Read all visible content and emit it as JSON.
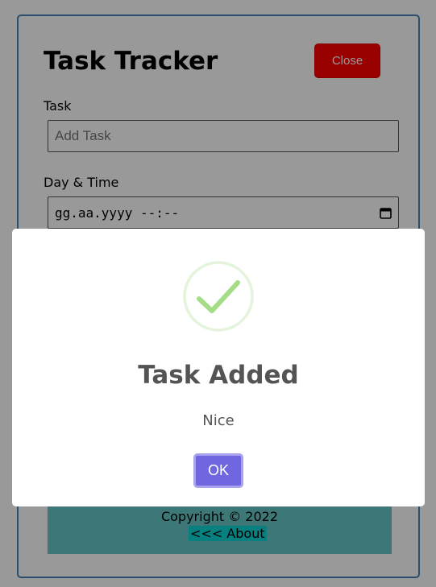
{
  "app": {
    "title": "Task Tracker",
    "close_label": "Close"
  },
  "form": {
    "task_label": "Task",
    "task_placeholder": "Add Task",
    "day_label": "Day & Time",
    "day_placeholder": "gg.aa.yyyy --:--"
  },
  "footer": {
    "copyright": "Copyright © 2022",
    "about_link": "<<< About"
  },
  "modal": {
    "icon": "success-check-icon",
    "title": "Task Added",
    "text": "Nice",
    "ok_label": "OK"
  },
  "colors": {
    "close_button": "#ff0000",
    "ok_button": "#7066e0",
    "footer_bg": "#68c7c7",
    "success": "#a5dc86"
  }
}
